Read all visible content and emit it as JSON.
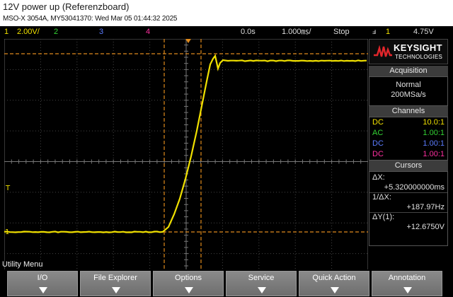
{
  "page": {
    "title": "12V power up (Referenzboard)",
    "subtitle": "MSO-X 3054A, MY53041370: Wed Mar 05 01:44:32 2025"
  },
  "status": {
    "ch1_num": "1",
    "ch1_scale": "2.00V/",
    "ch2_num": "2",
    "ch3_num": "3",
    "ch4_num": "4",
    "time_pos": "0.0s",
    "time_scale": "1.000㎳/",
    "run_state": "Stop",
    "trig_icon": "ⅎ",
    "trig_ch": "1",
    "trig_level": "4.75V"
  },
  "logo": {
    "brand": "KEYSIGHT",
    "sub": "TECHNOLOGIES"
  },
  "acquisition": {
    "title": "Acquisition",
    "mode": "Normal",
    "rate": "200MSa/s"
  },
  "channels": {
    "title": "Channels",
    "rows": [
      {
        "coupling": "DC",
        "probe": "10.0:1"
      },
      {
        "coupling": "AC",
        "probe": "1.00:1"
      },
      {
        "coupling": "DC",
        "probe": "1.00:1"
      },
      {
        "coupling": "DC",
        "probe": "1.00:1"
      }
    ]
  },
  "cursors": {
    "title": "Cursors",
    "dx_label": "ΔX:",
    "dx_value": "+5.320000000ms",
    "inv_dx_label": "1/ΔX:",
    "inv_dx_value": "+187.97Hz",
    "dy_label": "ΔY(1):",
    "dy_value": "+12.6750V"
  },
  "ch1_marker": "1",
  "trig_marker": "T",
  "menu": {
    "label": "Utility Menu",
    "keys": [
      "I/O",
      "File Explorer",
      "Options",
      "Service",
      "Quick Action",
      "Annotation"
    ]
  },
  "colors": {
    "ch1": "#f0e000",
    "ch2": "#33d233",
    "ch3": "#5b7cff",
    "ch4": "#ff2fa0",
    "cursor": "#e08a1c"
  },
  "waveform": {
    "description_free": true,
    "low_level_v": 0.0,
    "high_level_v": 12.0
  }
}
